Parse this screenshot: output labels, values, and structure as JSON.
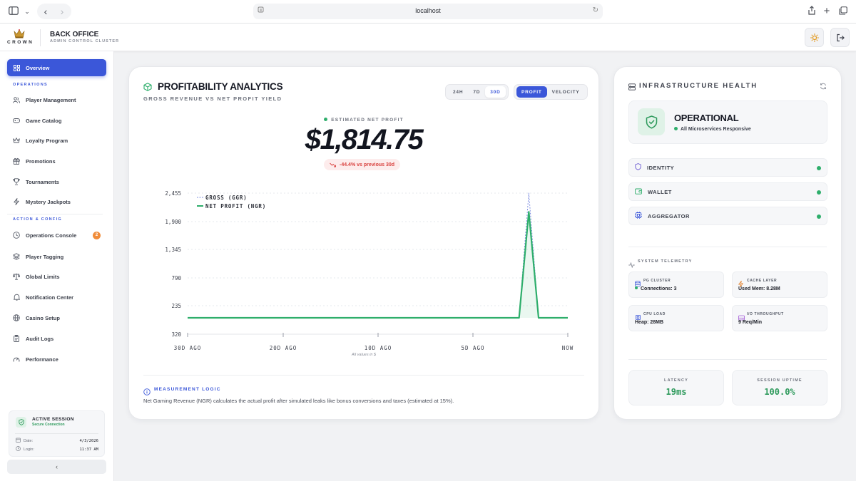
{
  "browser": {
    "url": "localhost"
  },
  "header": {
    "brand": "CROWN",
    "title": "BACK OFFICE",
    "subtitle": "ADMIN CONTROL CLUSTER"
  },
  "sidebar": {
    "items": [
      {
        "label": "Overview",
        "icon": "grid-icon",
        "active": true
      },
      {
        "label": "Player Management",
        "icon": "users-icon"
      },
      {
        "label": "Game Catalog",
        "icon": "gamepad-icon"
      },
      {
        "label": "Loyalty Program",
        "icon": "crown-icon"
      },
      {
        "label": "Promotions",
        "icon": "gift-icon"
      },
      {
        "label": "Tournaments",
        "icon": "trophy-icon"
      },
      {
        "label": "Mystery Jackpots",
        "icon": "zap-icon"
      },
      {
        "label": "Operations Console",
        "icon": "clock-icon",
        "badge": "2"
      },
      {
        "label": "Player Tagging",
        "icon": "layers-icon"
      },
      {
        "label": "Global Limits",
        "icon": "scale-icon"
      },
      {
        "label": "Notification Center",
        "icon": "bell-icon"
      },
      {
        "label": "Casino Setup",
        "icon": "globe-icon"
      },
      {
        "label": "Audit Logs",
        "icon": "clipboard-icon"
      },
      {
        "label": "Performance",
        "icon": "gauge-icon"
      }
    ],
    "sections": {
      "operations": "OPERATIONS",
      "action": "ACTION & CONFIG"
    },
    "session": {
      "title": "ACTIVE SESSION",
      "status": "Secure Connection",
      "date_label": "Date:",
      "date_value": "4/3/2026",
      "login_label": "Login:",
      "login_value": "11:37 AM"
    },
    "collapse_glyph": "‹"
  },
  "analytics": {
    "title": "PROFITABILITY ANALYTICS",
    "subtitle": "GROSS REVENUE VS NET PROFIT YIELD",
    "ranges": [
      "24H",
      "7D",
      "30D"
    ],
    "active_range": "30D",
    "modes": [
      "PROFIT",
      "VELOCITY"
    ],
    "active_mode": "PROFIT",
    "estimate_label": "ESTIMATED NET PROFIT",
    "estimate_value": "$1,814.75",
    "delta": "-44.4% vs previous 30d",
    "caption": "All values in $",
    "logic_title": "MEASUREMENT LOGIC",
    "logic_text": "Net Gaming Revenue (NGR) calculates the actual profit after simulated leaks like bonus conversions and taxes (estimated at 15%).",
    "colors": {
      "accent": "#3b57d9",
      "net": "#2eae6b",
      "gross": "#7f8fe0",
      "negative": "#d9423f"
    }
  },
  "chart_data": {
    "type": "line",
    "y_ticks": [
      "2,455",
      "1,900",
      "1,345",
      "790",
      "235",
      "320"
    ],
    "x_tick_labels": [
      "30D AGO",
      "20D AGO",
      "10D AGO",
      "5D AGO",
      "NOW"
    ],
    "ylim": [
      -320,
      2455
    ],
    "grid": true,
    "legend_position": "top-left",
    "series": [
      {
        "name": "GROSS (GGR)",
        "style": "dashed",
        "color": "#7f8fe0",
        "values": [
          0,
          0,
          0,
          0,
          0,
          0,
          0,
          0,
          0,
          0,
          0,
          0,
          0,
          0,
          0,
          0,
          0,
          0,
          0,
          0,
          0,
          0,
          0,
          0,
          0,
          0,
          0,
          0,
          0,
          0,
          0,
          0,
          0,
          0,
          0,
          2455,
          0,
          0,
          0,
          0
        ]
      },
      {
        "name": "NET PROFIT (NGR)",
        "style": "solid",
        "color": "#2eae6b",
        "values": [
          0,
          0,
          0,
          0,
          0,
          0,
          0,
          0,
          0,
          0,
          0,
          0,
          0,
          0,
          0,
          0,
          0,
          0,
          0,
          0,
          0,
          0,
          0,
          0,
          0,
          0,
          0,
          0,
          0,
          0,
          0,
          0,
          0,
          0,
          0,
          2087,
          0,
          0,
          0,
          0
        ]
      }
    ]
  },
  "infra": {
    "title": "INFRASTRUCTURE HEALTH",
    "status_title": "OPERATIONAL",
    "status_sub": "All Microservices Responsive",
    "services": [
      "IDENTITY",
      "WALLET",
      "AGGREGATOR"
    ],
    "telemetry_title": "SYSTEM TELEMETRY",
    "tiles": [
      {
        "label": "PG CLUSTER",
        "value": "Connections: 3",
        "dot": true
      },
      {
        "label": "CACHE LAYER",
        "value": "Used Mem: 8.28M"
      },
      {
        "label": "CPU LOAD",
        "value": "Heap: 28MB"
      },
      {
        "label": "I/O THROUGHPUT",
        "value": "9 Req/Min"
      }
    ],
    "latency_label": "LATENCY",
    "latency_value": "19ms",
    "uptime_label": "SESSION UPTIME",
    "uptime_value": "100.0%"
  }
}
